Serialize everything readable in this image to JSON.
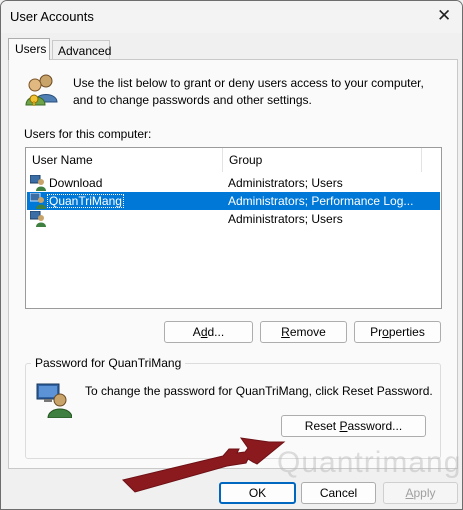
{
  "window": {
    "title": "User Accounts",
    "close_glyph": "✕"
  },
  "tabs": [
    {
      "label": "Users"
    },
    {
      "label": "Advanced"
    }
  ],
  "intro": {
    "text": "Use the list below to grant or deny users access to your computer, and to change passwords and other settings."
  },
  "users_list": {
    "label": "Users for this computer:",
    "columns": [
      "User Name",
      "Group"
    ],
    "rows": [
      {
        "name": "Download",
        "group": "Administrators; Users"
      },
      {
        "name": "QuanTriMang",
        "group": "Administrators; Performance Log...",
        "selected": true
      },
      {
        "name": "",
        "group": "Administrators; Users"
      }
    ]
  },
  "list_buttons": {
    "add_pre": "A",
    "add_ul": "d",
    "add_post": "d...",
    "remove_ul": "R",
    "remove_post": "emove",
    "props_pre": "Pr",
    "props_ul": "o",
    "props_post": "perties"
  },
  "password": {
    "legend": "Password for QuanTriMang",
    "text": "To change the password for QuanTriMang, click Reset Password.",
    "reset_pre": "Reset ",
    "reset_ul": "P",
    "reset_post": "assword..."
  },
  "watermark": "Quantrimang",
  "footer": {
    "ok": "OK",
    "cancel": "Cancel",
    "apply_ul": "A",
    "apply_post": "pply"
  },
  "colors": {
    "selection": "#0078d7",
    "arrow": "#8b1a1f",
    "ok_border": "#0067c0"
  },
  "icons": {
    "users": "users-group-icon",
    "user": "user-icon",
    "close": "close-icon"
  }
}
